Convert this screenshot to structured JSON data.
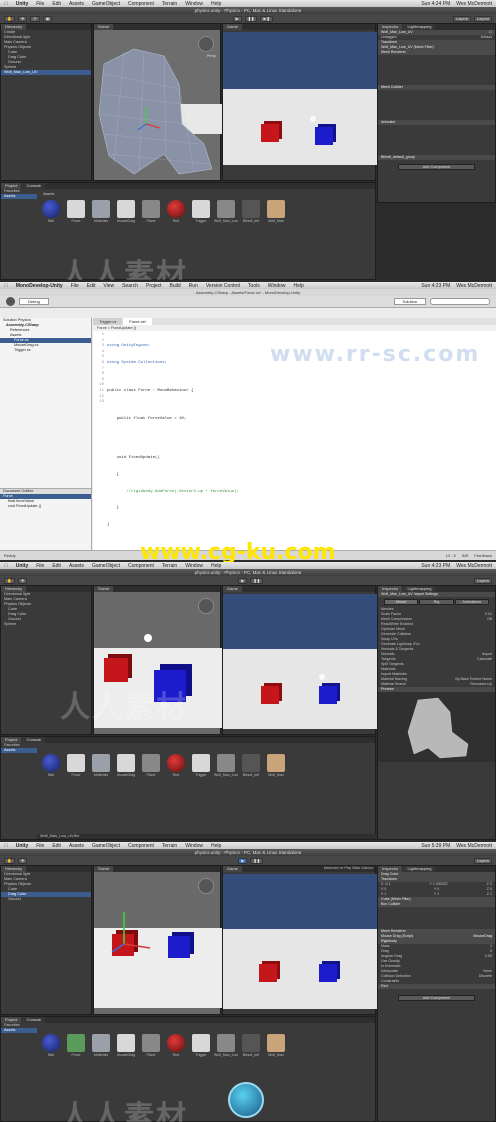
{
  "menu_unity": [
    "Unity",
    "File",
    "Edit",
    "Assets",
    "GameObject",
    "Component",
    "Terrain",
    "Window",
    "Help"
  ],
  "clock": [
    "Sun 4:24 PM",
    "Wes McDermott"
  ],
  "clock2": [
    "Sun 4:23 PM",
    "Wes McDermott"
  ],
  "clock3": [
    "Sun 5:39 PM",
    "Wes McDermott"
  ],
  "title_unity": "physics.unity - Physics - PC, Mac & Linux Standalone",
  "hierarchy": {
    "tab": "Hierarchy",
    "create": "Create",
    "items": [
      "Directional light",
      "Main Camera",
      "Physics Objects",
      "Cube",
      "Drag Cube",
      "Ground",
      "Sphere",
      "Wolf_Man_Low_UV"
    ]
  },
  "scene_tab": "Scene",
  "game_tab": "Game",
  "persp": "Persp",
  "project": {
    "tab": "Project",
    "console_tab": "Console",
    "favorites": "Favorites",
    "assets_folder": "Assets",
    "assets_label": "Assets",
    "items": [
      "Ball",
      "Force",
      "Materials",
      "MouseDrag",
      "Plane",
      "Red",
      "Trigger",
      "Wolf_Man_Low",
      "Blinn6_def",
      "Wolf_Man"
    ]
  },
  "inspector": {
    "tab": "Inspector",
    "lightmap_tab": "Lightmapping",
    "name": "Wolf_Man_Low_UV",
    "tag": "Untagged",
    "layer": "Default",
    "transform": "Transform",
    "mesh_filter": "Wolf_Man_Low_UV (Mesh Filter)",
    "mesh_renderer": "Mesh Renderer",
    "mesh_collider": "Mesh Collider",
    "animator": "Animator",
    "material": "Blinn6_default_group",
    "add_component": "Add Component"
  },
  "mono": {
    "menu": [
      "MonoDevelop-Unity",
      "File",
      "Edit",
      "View",
      "Search",
      "Project",
      "Build",
      "Run",
      "Version Control",
      "Tools",
      "Window",
      "Help"
    ],
    "title": "Assembly-CSharp - Assets/Force.cs* - MonoDevelop-Unity",
    "config": "Debug",
    "solution_label": "Solution",
    "tab_files": [
      "Trigger.cs",
      "Force.cs*"
    ],
    "breadcrumb": "Force  >  FixedUpdate ()",
    "solution_tree": [
      "Solution Physics",
      "Assembly-CSharp",
      "References",
      "Assets",
      "Force.cs",
      "MouseDrag.cs",
      "Trigger.cs"
    ],
    "outline_title": "Document Outline",
    "outline_items": [
      "Force",
      "float forceValue",
      "void FixedUpdate ()"
    ],
    "code": [
      "using UnityEngine;",
      "using System.Collections;",
      "",
      "public class Force : MonoBehaviour {",
      "",
      "    public float forceValue = 10;",
      "",
      "",
      "    void FixedUpdate()",
      "    {",
      "        //rigidbody.AddForce(-Vector3.up * forceValue);",
      "    }",
      "}"
    ],
    "line_numbers": [
      "1",
      "2",
      "3",
      "4",
      "5",
      "6",
      "7",
      "8",
      "9",
      "10",
      "11",
      "12",
      "13"
    ],
    "status_ready": "Ready",
    "status_pos": "12 : 5",
    "status_ins": "INS",
    "feedback": "Feedback"
  },
  "watermark_url": "www.cg-ku.com",
  "import": {
    "name": "Wolf_Man_Low_UV Import Settings",
    "tabs": [
      "Model",
      "Rig",
      "Animations"
    ],
    "rows": [
      [
        "Meshes",
        ""
      ],
      [
        "Scale Factor",
        "0.01"
      ],
      [
        "Mesh Compression",
        "Off"
      ],
      [
        "Read/Write Enabled",
        ""
      ],
      [
        "Optimize Mesh",
        ""
      ],
      [
        "Generate Colliders",
        ""
      ],
      [
        "Swap UVs",
        ""
      ],
      [
        "Generate Lightmap UVs",
        ""
      ],
      [
        "Normals & Tangents",
        ""
      ],
      [
        "Normals",
        "Import"
      ],
      [
        "Tangents",
        "Calculate"
      ],
      [
        "Split Tangents",
        ""
      ],
      [
        "Materials",
        ""
      ],
      [
        "Import Materials",
        ""
      ],
      [
        "Material Naming",
        "By Base Texture Name"
      ],
      [
        "Material Search",
        "Recursive-Up"
      ]
    ],
    "preview": "Preview"
  },
  "path_bar": "Wolf_Man_Low_UV.fbx",
  "drag_inspector": {
    "name": "Drag Cube",
    "transform": "Transform",
    "position": [
      "X -0.1",
      "Y 1.053337",
      "Z 0"
    ],
    "rotation": [
      "X 0",
      "Y 0",
      "Z 0"
    ],
    "scale": [
      "X 1",
      "Y 1",
      "Z 1"
    ],
    "mesh_filter": "Cube (Mesh Filter)",
    "box_collider": "Box Collider",
    "mesh_renderer": "Mesh Renderer",
    "mouse_drag": "Mouse Drag (Script)",
    "script": "MouseDrag",
    "rigidbody": "Rigidbody",
    "rb_rows": [
      [
        "Mass",
        "1"
      ],
      [
        "Drag",
        "0"
      ],
      [
        "Angular Drag",
        "0.05"
      ],
      [
        "Use Gravity",
        ""
      ],
      [
        "Is Kinematic",
        ""
      ],
      [
        "Interpolate",
        "None"
      ],
      [
        "Collision Detection",
        "Discrete"
      ],
      [
        "Constraints",
        ""
      ]
    ],
    "material": "Red",
    "add_component": "Add Component"
  },
  "game_bar": [
    "Maximize on Play",
    "Stats",
    "Gizmos"
  ],
  "free_aspect": "Free Aspect"
}
